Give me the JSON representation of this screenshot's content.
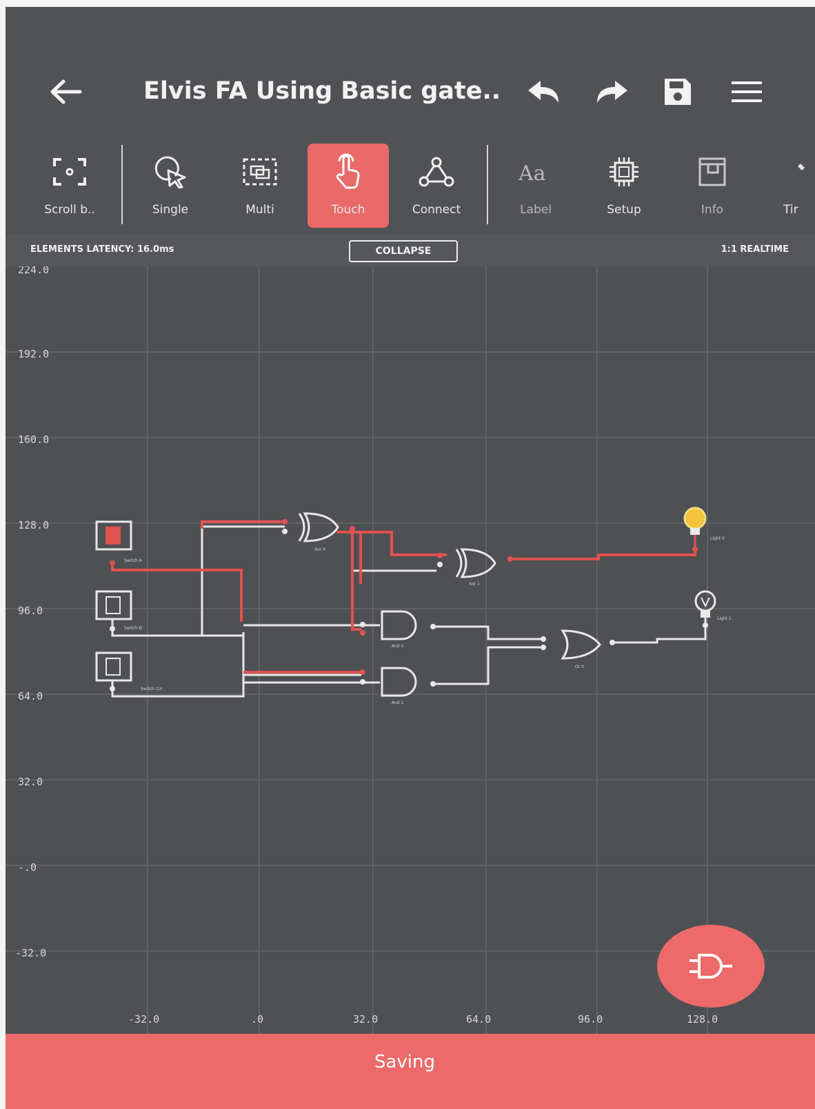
{
  "header": {
    "title": "Elvis FA Using Basic gate..",
    "back_icon": "arrow-left-icon",
    "undo_icon": "undo-icon",
    "redo_icon": "redo-icon",
    "save_icon": "floppy-disk-icon",
    "menu_icon": "hamburger-menu-icon"
  },
  "toolbar": {
    "tools": [
      {
        "label": "Scroll b..",
        "icon": "scroll-focus-icon",
        "active": false
      },
      {
        "label": "Single",
        "icon": "single-select-icon",
        "active": false
      },
      {
        "label": "Multi",
        "icon": "multi-select-icon",
        "active": false
      },
      {
        "label": "Touch",
        "icon": "touch-hand-icon",
        "active": true
      },
      {
        "label": "Connect",
        "icon": "connect-nodes-icon",
        "active": false
      },
      {
        "label": "Label",
        "icon": "text-label-icon",
        "active": false
      },
      {
        "label": "Setup",
        "icon": "chip-setup-icon",
        "active": false
      },
      {
        "label": "Info",
        "icon": "info-box-icon",
        "active": false
      },
      {
        "label": "Tir",
        "icon": "timing-icon",
        "active": false
      }
    ]
  },
  "status": {
    "latency": "ELEMENTS LATENCY: 16.0ms",
    "collapse_label": "COLLAPSE",
    "realtime": "1:1 REALTIME"
  },
  "grid": {
    "y_labels": [
      "224.0",
      "192.0",
      "160.0",
      "128.0",
      "96.0",
      "64.0",
      "32.0",
      "-.0",
      "-32.0"
    ],
    "x_labels": [
      "-32.0",
      ".0",
      "32.0",
      "64.0",
      "96.0",
      "128.0"
    ]
  },
  "circuit": {
    "switch_labels": [
      "Switch A",
      "Switch B",
      "Switch Cin"
    ],
    "gate_labels": [
      "Xor 0",
      "Xor 1",
      "And 0",
      "And 1",
      "Or 0"
    ],
    "light_labels": [
      "Light 0",
      "Light 1"
    ],
    "wire_active_color": "#e0524f",
    "wire_idle_color": "#e8e8e8"
  },
  "fab": {
    "icon": "plug-add-icon"
  },
  "footer": {
    "status": "Saving"
  },
  "colors": {
    "accent": "#ec6a69",
    "background": "#4e5053"
  }
}
